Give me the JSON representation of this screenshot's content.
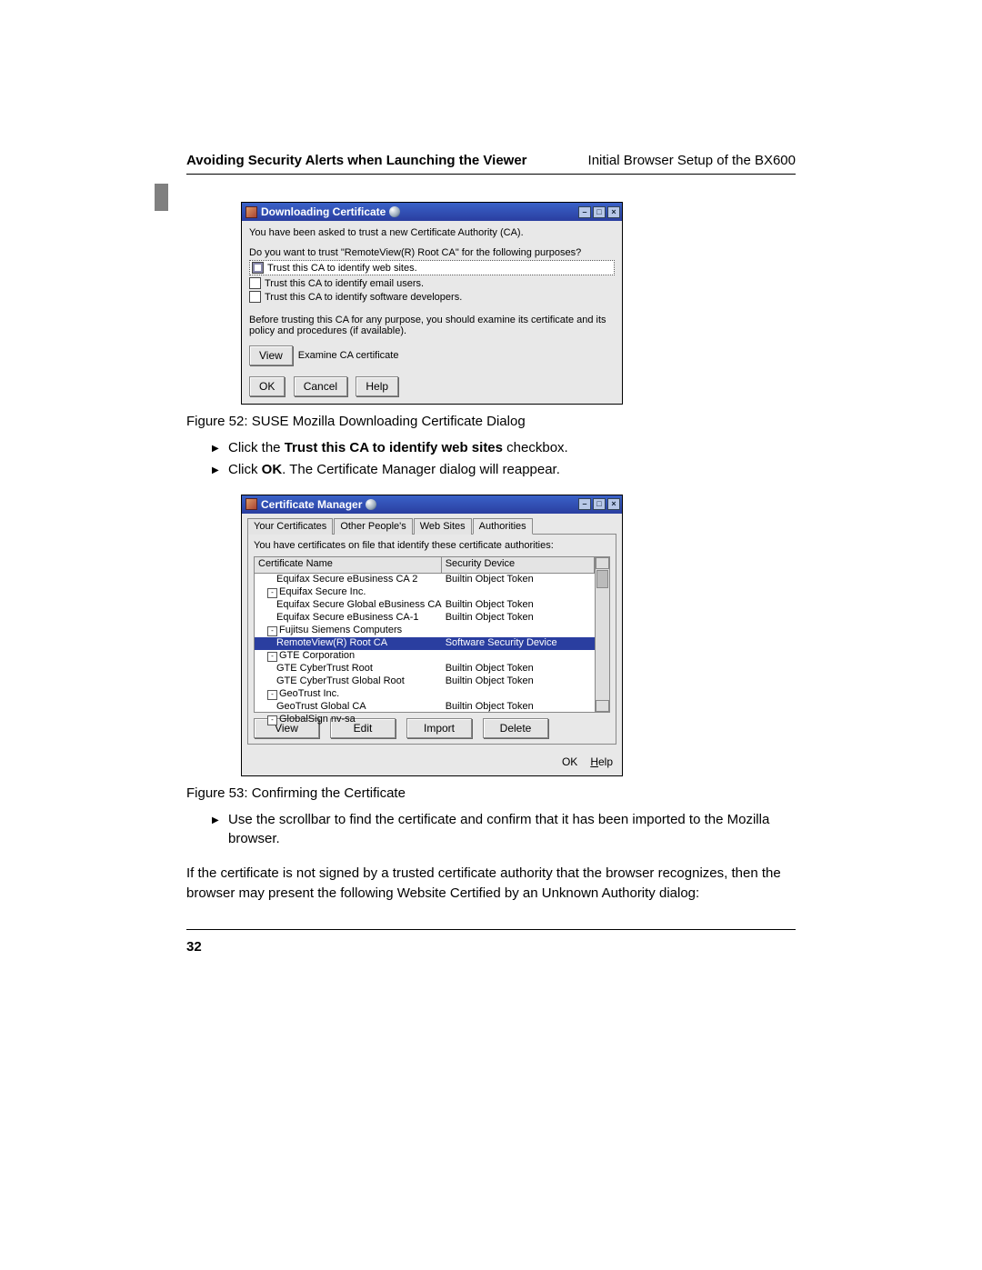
{
  "header": {
    "left": "Avoiding Security Alerts when Launching the Viewer",
    "right": "Initial Browser Setup of the BX600"
  },
  "page_number": "32",
  "dialog1": {
    "title": "Downloading Certificate",
    "line1": "You have been asked to trust a new Certificate Authority (CA).",
    "line2": "Do you want to trust \"RemoteView(R) Root CA\" for the following purposes?",
    "opt1": "Trust this CA to identify web sites.",
    "opt2": "Trust this CA to identify email users.",
    "opt3": "Trust this CA to identify software developers.",
    "warning": "Before trusting this CA for any purpose, you should examine its certificate and its policy and procedures (if available).",
    "btn_view": "View",
    "examine": "Examine CA certificate",
    "btn_ok": "OK",
    "btn_cancel": "Cancel",
    "btn_help": "Help",
    "caption": "Figure 52: SUSE Mozilla Downloading Certificate Dialog"
  },
  "bullets1": {
    "b1_pre": "Click the ",
    "b1_bold": "Trust this CA to identify web sites",
    "b1_post": " checkbox.",
    "b2_pre": "Click ",
    "b2_bold": "OK",
    "b2_post": ". The Certificate Manager dialog will reappear."
  },
  "dialog2": {
    "title": "Certificate Manager",
    "tabs": {
      "t1": "Your Certificates",
      "t2": "Other People's",
      "t3": "Web Sites",
      "t4": "Authorities"
    },
    "intro": "You have certificates on file that identify these certificate authorities:",
    "col1": "Certificate Name",
    "col2": "Security Device",
    "rows": [
      {
        "c1": "Equifax Secure eBusiness CA 2",
        "c2": "Builtin Object Token",
        "indent": 2
      },
      {
        "c1": "Equifax Secure Inc.",
        "c2": "",
        "indent": 1,
        "exp": "-"
      },
      {
        "c1": "Equifax Secure Global eBusiness CA...",
        "c2": "Builtin Object Token",
        "indent": 2
      },
      {
        "c1": "Equifax Secure eBusiness CA-1",
        "c2": "Builtin Object Token",
        "indent": 2
      },
      {
        "c1": "Fujitsu Siemens Computers",
        "c2": "",
        "indent": 1,
        "exp": "-"
      },
      {
        "c1": "RemoteView(R) Root CA",
        "c2": "Software Security Device",
        "indent": 2,
        "selected": true
      },
      {
        "c1": "GTE Corporation",
        "c2": "",
        "indent": 1,
        "exp": "-"
      },
      {
        "c1": "GTE CyberTrust Root",
        "c2": "Builtin Object Token",
        "indent": 2
      },
      {
        "c1": "GTE CyberTrust Global Root",
        "c2": "Builtin Object Token",
        "indent": 2
      },
      {
        "c1": "GeoTrust Inc.",
        "c2": "",
        "indent": 1,
        "exp": "-"
      },
      {
        "c1": "GeoTrust Global CA",
        "c2": "Builtin Object Token",
        "indent": 2
      },
      {
        "c1": "GlobalSign nv-sa",
        "c2": "",
        "indent": 1,
        "exp": "-"
      }
    ],
    "btn_view": "View",
    "btn_edit": "Edit",
    "btn_import": "Import",
    "btn_delete": "Delete",
    "btn_ok": "OK",
    "btn_help": "Help",
    "caption": "Figure 53: Confirming the Certificate"
  },
  "bullets2": {
    "b1": "Use the scrollbar to find the certificate and confirm that it has been imported to the Mozilla browser."
  },
  "paragraph": "If the certificate is not signed by a trusted certificate authority that the browser recognizes, then the browser may present the following Website Certified by an Unknown Authority dialog:"
}
